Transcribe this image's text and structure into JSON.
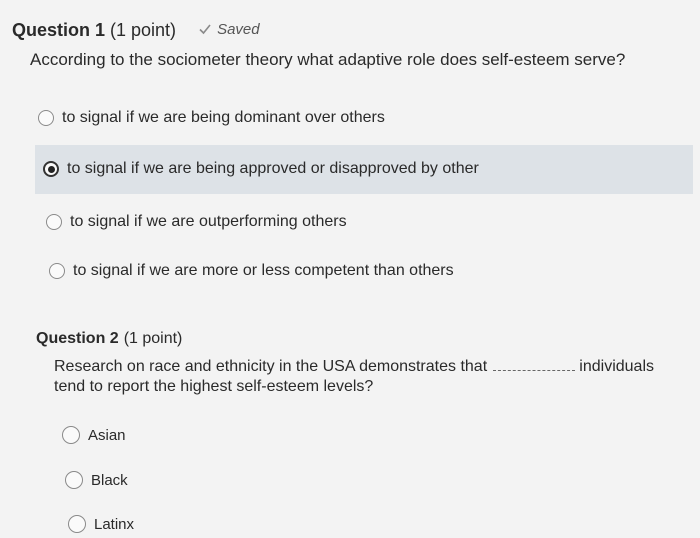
{
  "question1": {
    "title": "Question 1",
    "points": "(1 point)",
    "saved": "Saved",
    "text": "According to the sociometer theory what adaptive role does self-esteem serve?",
    "options": [
      {
        "label": "to signal if we are being dominant over others",
        "selected": false
      },
      {
        "label": "to signal if we are being approved or disapproved by other",
        "selected": true
      },
      {
        "label": "to signal if we are outperforming others",
        "selected": false
      },
      {
        "label": "to signal if we are more or less competent than others",
        "selected": false
      }
    ]
  },
  "question2": {
    "title": "Question 2",
    "points": "(1 point)",
    "text_before": "Research on race and ethnicity in the USA demonstrates that",
    "text_after": "individuals",
    "text_line2": "tend to report the highest self-esteem levels?",
    "options": [
      {
        "label": "Asian",
        "selected": false
      },
      {
        "label": "Black",
        "selected": false
      },
      {
        "label": "Latinx",
        "selected": false
      }
    ]
  }
}
